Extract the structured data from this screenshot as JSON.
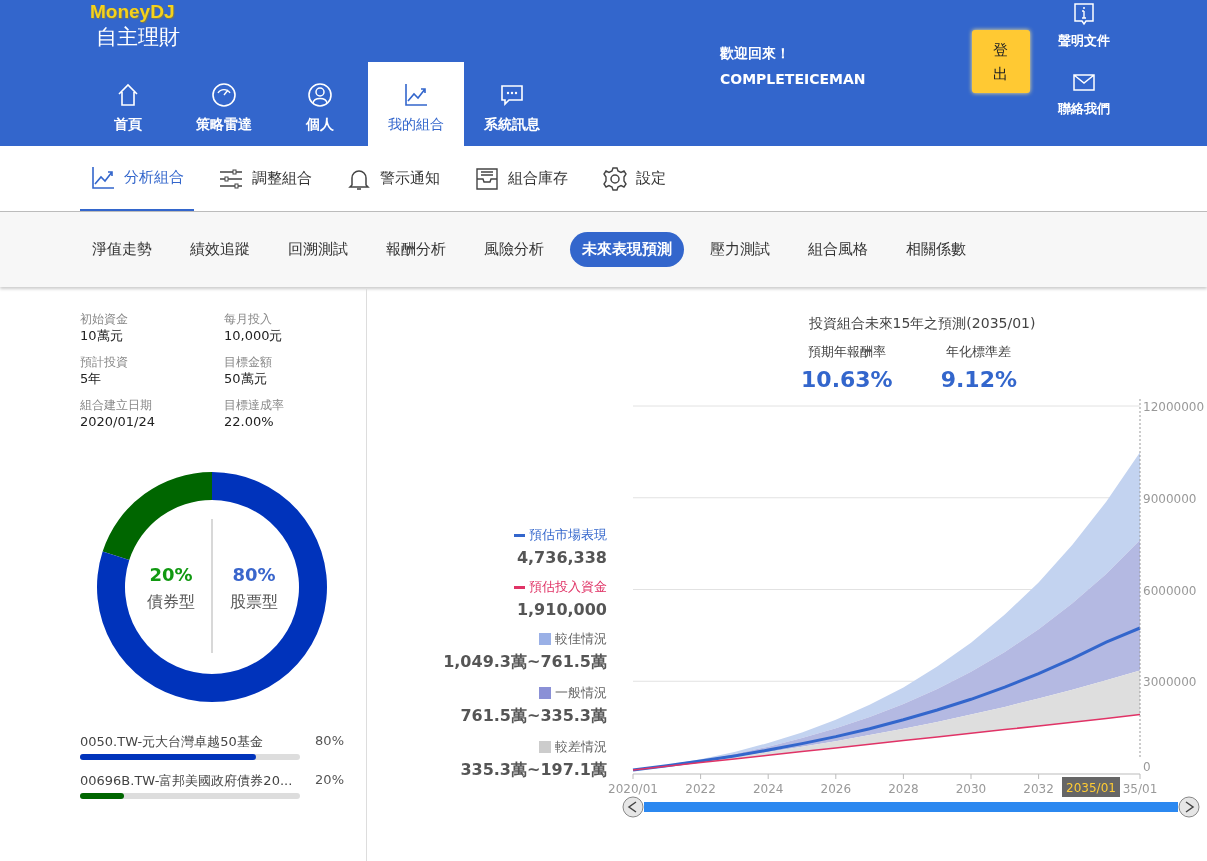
{
  "header": {
    "logo": "MoneyDJ",
    "subtitle": "自主理財",
    "welcome": "歡迎回來！",
    "username": "COMPLETEICEMAN",
    "logout": "登出",
    "nav": [
      {
        "label": "首頁",
        "selected": false
      },
      {
        "label": "策略雷達",
        "selected": false
      },
      {
        "label": "個人",
        "selected": false
      },
      {
        "label": "我的組合",
        "selected": true
      },
      {
        "label": "系統訊息",
        "selected": false
      }
    ],
    "links": [
      {
        "label": "聲明文件"
      },
      {
        "label": "聯絡我們"
      }
    ]
  },
  "subnav": [
    {
      "label": "分析組合",
      "selected": true
    },
    {
      "label": "調整組合",
      "selected": false
    },
    {
      "label": "警示通知",
      "selected": false
    },
    {
      "label": "組合庫存",
      "selected": false
    },
    {
      "label": "設定",
      "selected": false
    }
  ],
  "tabs": [
    {
      "label": "淨值走勢",
      "selected": false
    },
    {
      "label": "績效追蹤",
      "selected": false
    },
    {
      "label": "回溯測試",
      "selected": false
    },
    {
      "label": "報酬分析",
      "selected": false
    },
    {
      "label": "風險分析",
      "selected": false
    },
    {
      "label": "未來表現預測",
      "selected": true
    },
    {
      "label": "壓力測試",
      "selected": false
    },
    {
      "label": "組合風格",
      "selected": false
    },
    {
      "label": "相關係數",
      "selected": false
    }
  ],
  "summary": [
    {
      "label": "初始資金",
      "value": "10萬元"
    },
    {
      "label": "每月投入",
      "value": "10,000元"
    },
    {
      "label": "預計投資",
      "value": "5年"
    },
    {
      "label": "目標金額",
      "value": "50萬元"
    },
    {
      "label": "組合建立日期",
      "value": "2020/01/24"
    },
    {
      "label": "目標達成率",
      "value": "22.00%"
    }
  ],
  "allocation": {
    "chart_data": {
      "type": "donut",
      "categories": [
        "債券型",
        "股票型"
      ],
      "values": [
        20,
        80
      ],
      "value_labels": [
        "20%",
        "80%"
      ]
    }
  },
  "holdings": [
    {
      "name": "0050.TW-元大台灣卓越50基金",
      "percent": "80%",
      "level": 0.8,
      "color": "#0033bb"
    },
    {
      "name": "00696B.TW-富邦美國政府債券20...",
      "percent": "20%",
      "level": 0.2,
      "color": "#006600"
    }
  ],
  "forecast": {
    "title": "投資組合未來15年之預測(2035/01)",
    "stats": [
      {
        "label": "預期年報酬率",
        "value": "10.63%"
      },
      {
        "label": "年化標準差",
        "value": "9.12%"
      }
    ],
    "legend": [
      {
        "kind": "line",
        "value": "4,736,338",
        "color": "#3366cc"
      },
      {
        "kind": "line",
        "value": "1,910,000",
        "color": "#e03366"
      },
      {
        "kind": "band",
        "value": "1,049.3萬~761.5萬",
        "color": "#9ab0e6"
      },
      {
        "kind": "band",
        "value": "761.5萬~335.3萬",
        "color": "#8a90d6"
      },
      {
        "kind": "band",
        "value": "335.3萬~197.1萬",
        "color": "#cccccc"
      }
    ],
    "tooltip": "2035/01",
    "chart_data": {
      "type": "area",
      "x": [
        2020,
        2021,
        2022,
        2023,
        2024,
        2025,
        2026,
        2027,
        2028,
        2029,
        2030,
        2031,
        2032,
        2033,
        2034,
        2035
      ],
      "xlim": [
        2020,
        2035
      ],
      "ylim": [
        0,
        12000000
      ],
      "xticks": [
        {
          "value": 2020,
          "label": "2020/01"
        },
        2022,
        2024,
        2026,
        2028,
        2030,
        2032,
        {
          "value": 2035,
          "label": "35/01"
        }
      ],
      "yticks": [
        0,
        3000000,
        6000000,
        9000000,
        12000000
      ],
      "grid": true,
      "series": [
        {
          "name": "預估市場表現",
          "type": "line",
          "color": "#3366cc",
          "values": [
            100000,
            240000,
            390000,
            560000,
            750000,
            960000,
            1190000,
            1450000,
            1740000,
            2060000,
            2410000,
            2810000,
            3250000,
            3740000,
            4280000,
            4740000
          ]
        },
        {
          "name": "預估投入資金",
          "type": "line",
          "color": "#e03366",
          "values": [
            100000,
            220000,
            340000,
            460000,
            580000,
            700000,
            820000,
            940000,
            1060000,
            1180000,
            1300000,
            1420000,
            1540000,
            1660000,
            1780000,
            1910000
          ]
        },
        {
          "name": "較佳情況",
          "type": "area",
          "color": "#c3d3f0",
          "values": [
            100000,
            260000,
            450000,
            690000,
            980000,
            1320000,
            1740000,
            2230000,
            2800000,
            3480000,
            4260000,
            5180000,
            6230000,
            7460000,
            8870000,
            10490000
          ]
        },
        {
          "name": "一般情況",
          "type": "area",
          "color": "#b4b9e2",
          "values": [
            100000,
            250000,
            420000,
            620000,
            860000,
            1140000,
            1460000,
            1830000,
            2260000,
            2750000,
            3310000,
            3960000,
            4700000,
            5550000,
            6510000,
            7620000
          ]
        },
        {
          "name": "較差情況",
          "type": "area",
          "color": "#dedede",
          "values": [
            100000,
            230000,
            370000,
            520000,
            690000,
            860000,
            1040000,
            1240000,
            1450000,
            1670000,
            1910000,
            2160000,
            2440000,
            2720000,
            3030000,
            3350000
          ]
        }
      ]
    }
  }
}
